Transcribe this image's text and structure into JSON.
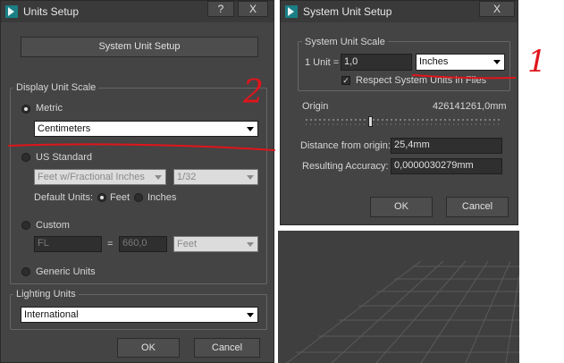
{
  "units_setup": {
    "title": "Units Setup",
    "help_btn": "?",
    "close_btn": "X",
    "system_unit_setup_btn": "System Unit Setup",
    "display_unit_scale": "Display Unit Scale",
    "metric_label": "Metric",
    "metric_value": "Centimeters",
    "us_standard_label": "US Standard",
    "us_unit_value": "Feet w/Fractional Inches",
    "us_fraction_value": "1/32",
    "default_units_label": "Default Units:",
    "feet_label": "Feet",
    "inches_label": "Inches",
    "custom_label": "Custom",
    "custom_name_value": "FL",
    "equals": "=",
    "custom_amount_value": "660,0",
    "custom_unit_value": "Feet",
    "generic_units_label": "Generic Units",
    "lighting_units_label": "Lighting Units",
    "lighting_value": "International",
    "ok_btn": "OK",
    "cancel_btn": "Cancel"
  },
  "system_unit_setup": {
    "title": "System Unit Setup",
    "close_btn": "X",
    "scale_group": "System Unit Scale",
    "one_unit_label": "1 Unit =",
    "one_unit_value": "1,0",
    "unit_value": "Inches",
    "respect_label": "Respect System Units in Files",
    "origin_label": "Origin",
    "origin_value": "426141261,0mm",
    "distance_label": "Distance from origin:",
    "distance_value": "25,4mm",
    "accuracy_label": "Resulting Accuracy:",
    "accuracy_value": "0,0000030279mm",
    "ok_btn": "OK",
    "cancel_btn": "Cancel"
  },
  "annotations": {
    "mark_1": "1",
    "mark_2": "2",
    "ink_color": "#e0151b"
  }
}
